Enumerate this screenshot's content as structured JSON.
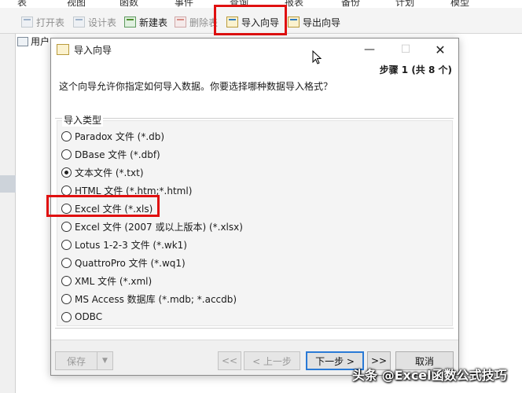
{
  "menubar": {
    "items": [
      "表",
      "视图",
      "函数",
      "事件",
      "查询",
      "报表",
      "备份",
      "计划",
      "模型"
    ]
  },
  "toolbar": {
    "items": [
      {
        "label": "打开表",
        "icon": "open-table-icon",
        "disabled": true
      },
      {
        "label": "设计表",
        "icon": "design-table-icon",
        "disabled": true
      },
      {
        "label": "新建表",
        "icon": "new-table-icon",
        "disabled": false
      },
      {
        "label": "删除表",
        "icon": "delete-table-icon",
        "disabled": true
      },
      {
        "label": "导入向导",
        "icon": "import-wizard-icon",
        "disabled": false
      },
      {
        "label": "导出向导",
        "icon": "export-wizard-icon",
        "disabled": false
      }
    ]
  },
  "tree": {
    "label": "用户"
  },
  "dialog": {
    "title": "导入向导",
    "step": "步骤 1 (共 8 个)",
    "prompt": "这个向导允许你指定如何导入数据。你要选择哪种数据导入格式？",
    "group_label": "导入类型",
    "options": [
      {
        "label": "Paradox 文件 (*.db)",
        "checked": false
      },
      {
        "label": "DBase 文件 (*.dbf)",
        "checked": false
      },
      {
        "label": "文本文件 (*.txt)",
        "checked": true
      },
      {
        "label": "HTML 文件 (*.htm;*.html)",
        "checked": false
      },
      {
        "label": "Excel 文件 (*.xls)",
        "checked": false
      },
      {
        "label": "Excel 文件 (2007 或以上版本) (*.xlsx)",
        "checked": false
      },
      {
        "label": "Lotus 1-2-3 文件 (*.wk1)",
        "checked": false
      },
      {
        "label": "QuattroPro 文件 (*.wq1)",
        "checked": false
      },
      {
        "label": "XML 文件 (*.xml)",
        "checked": false
      },
      {
        "label": "MS Access 数据库 (*.mdb; *.accdb)",
        "checked": false
      },
      {
        "label": "ODBC",
        "checked": false
      }
    ],
    "buttons": {
      "save": "保存",
      "first": "<<",
      "prev": "< 上一步",
      "next": "下一步 >",
      "last": ">>",
      "cancel": "取消"
    }
  },
  "watermark": "头条 @Excel函数公式技巧",
  "colors": {
    "highlight": "#e01010",
    "default_button": "#2a7ad6"
  }
}
